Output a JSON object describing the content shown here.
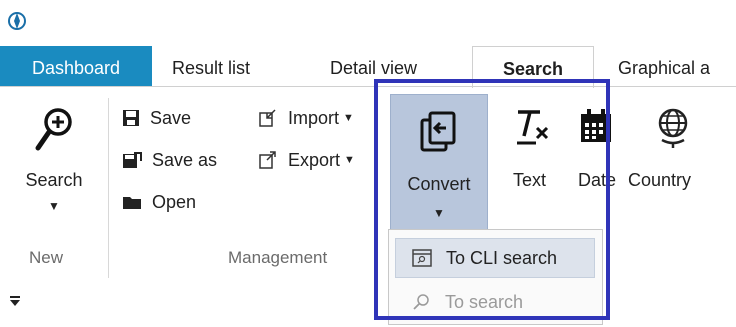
{
  "tabs": [
    {
      "label": "Dashboard"
    },
    {
      "label": "Result list"
    },
    {
      "label": "Detail view"
    },
    {
      "label": "Search"
    },
    {
      "label": "Graphical a"
    }
  ],
  "ribbon": {
    "new_group": {
      "search_label": "Search",
      "group_label": "New"
    },
    "management_group": {
      "save_label": "Save",
      "save_as_label": "Save as",
      "open_label": "Open",
      "import_label": "Import",
      "export_label": "Export",
      "group_label": "Management"
    },
    "convert_label": "Convert",
    "text_label": "Text",
    "date_label": "Date",
    "country_label": "Country"
  },
  "dropdown": {
    "items": [
      {
        "label": "To CLI search",
        "state": "highlighted"
      },
      {
        "label": "To search",
        "state": "disabled"
      }
    ]
  },
  "colors": {
    "active_tab": "#1a8bc0",
    "convert_pressed": "#b8c6dc",
    "focus_outline": "#2f34b8"
  }
}
